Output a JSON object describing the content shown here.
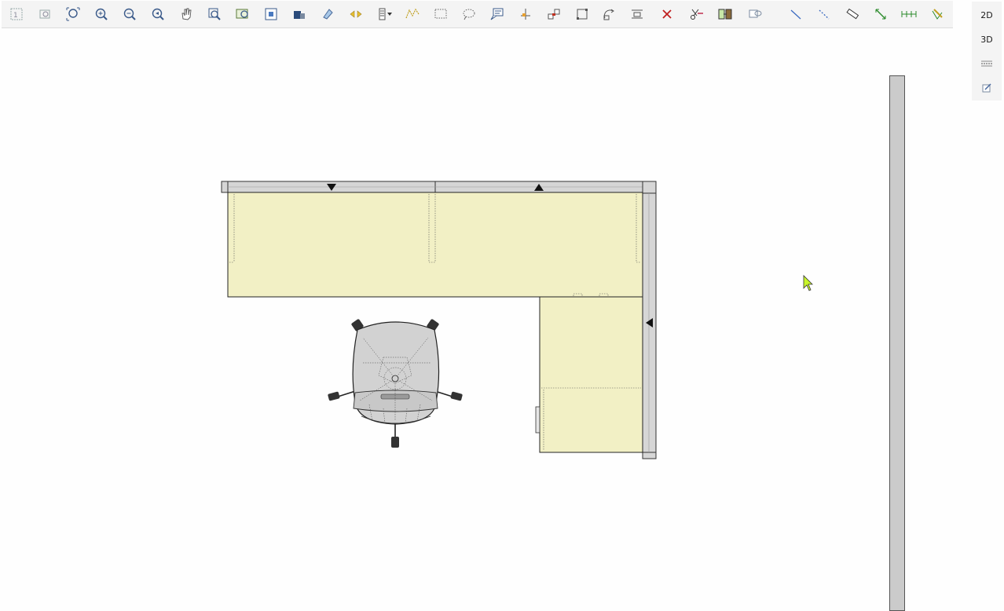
{
  "toolbar": {
    "buttons": [
      {
        "icon": "select-all-icon"
      },
      {
        "icon": "print-preview-icon"
      },
      {
        "icon": "zoom-extents-icon"
      },
      {
        "icon": "zoom-in-icon"
      },
      {
        "icon": "zoom-out-icon"
      },
      {
        "icon": "zoom-previous-icon"
      },
      {
        "icon": "pan-hand-icon"
      },
      {
        "icon": "zoom-window-icon"
      },
      {
        "icon": "zoom-selection-icon"
      },
      {
        "icon": "select-box-icon"
      },
      {
        "icon": "catalog-icon"
      },
      {
        "icon": "paint-icon"
      },
      {
        "icon": "flip-icon"
      },
      {
        "icon": "layers-dropdown-icon"
      },
      {
        "icon": "polyline-icon"
      },
      {
        "icon": "rectangle-select-icon"
      },
      {
        "icon": "lasso-select-icon"
      },
      {
        "icon": "annotation-icon"
      },
      {
        "icon": "insert-point-icon"
      },
      {
        "icon": "connect-icon"
      },
      {
        "icon": "move-icon"
      },
      {
        "icon": "rotate-icon"
      },
      {
        "icon": "align-icon"
      },
      {
        "icon": "delete-icon"
      },
      {
        "icon": "cut-replace-icon"
      },
      {
        "icon": "group-replace-icon"
      },
      {
        "icon": "swap-icon"
      },
      {
        "icon": "line-icon"
      },
      {
        "icon": "dashed-line-icon"
      },
      {
        "icon": "measure-icon"
      },
      {
        "icon": "dimension-icon"
      },
      {
        "icon": "chain-dimension-icon"
      },
      {
        "icon": "pencil-ruler-icon"
      }
    ]
  },
  "view_panel": {
    "view_2d": "2D",
    "view_3d": "3D",
    "icons": [
      "layout-icon",
      "notes-icon"
    ]
  },
  "colors": {
    "worksurface": "#f2f0c5",
    "panel": "#d6d6d6",
    "wall": "#cbcbcb",
    "chair": "#d2d2d2",
    "cursor": "#c8f52a"
  }
}
